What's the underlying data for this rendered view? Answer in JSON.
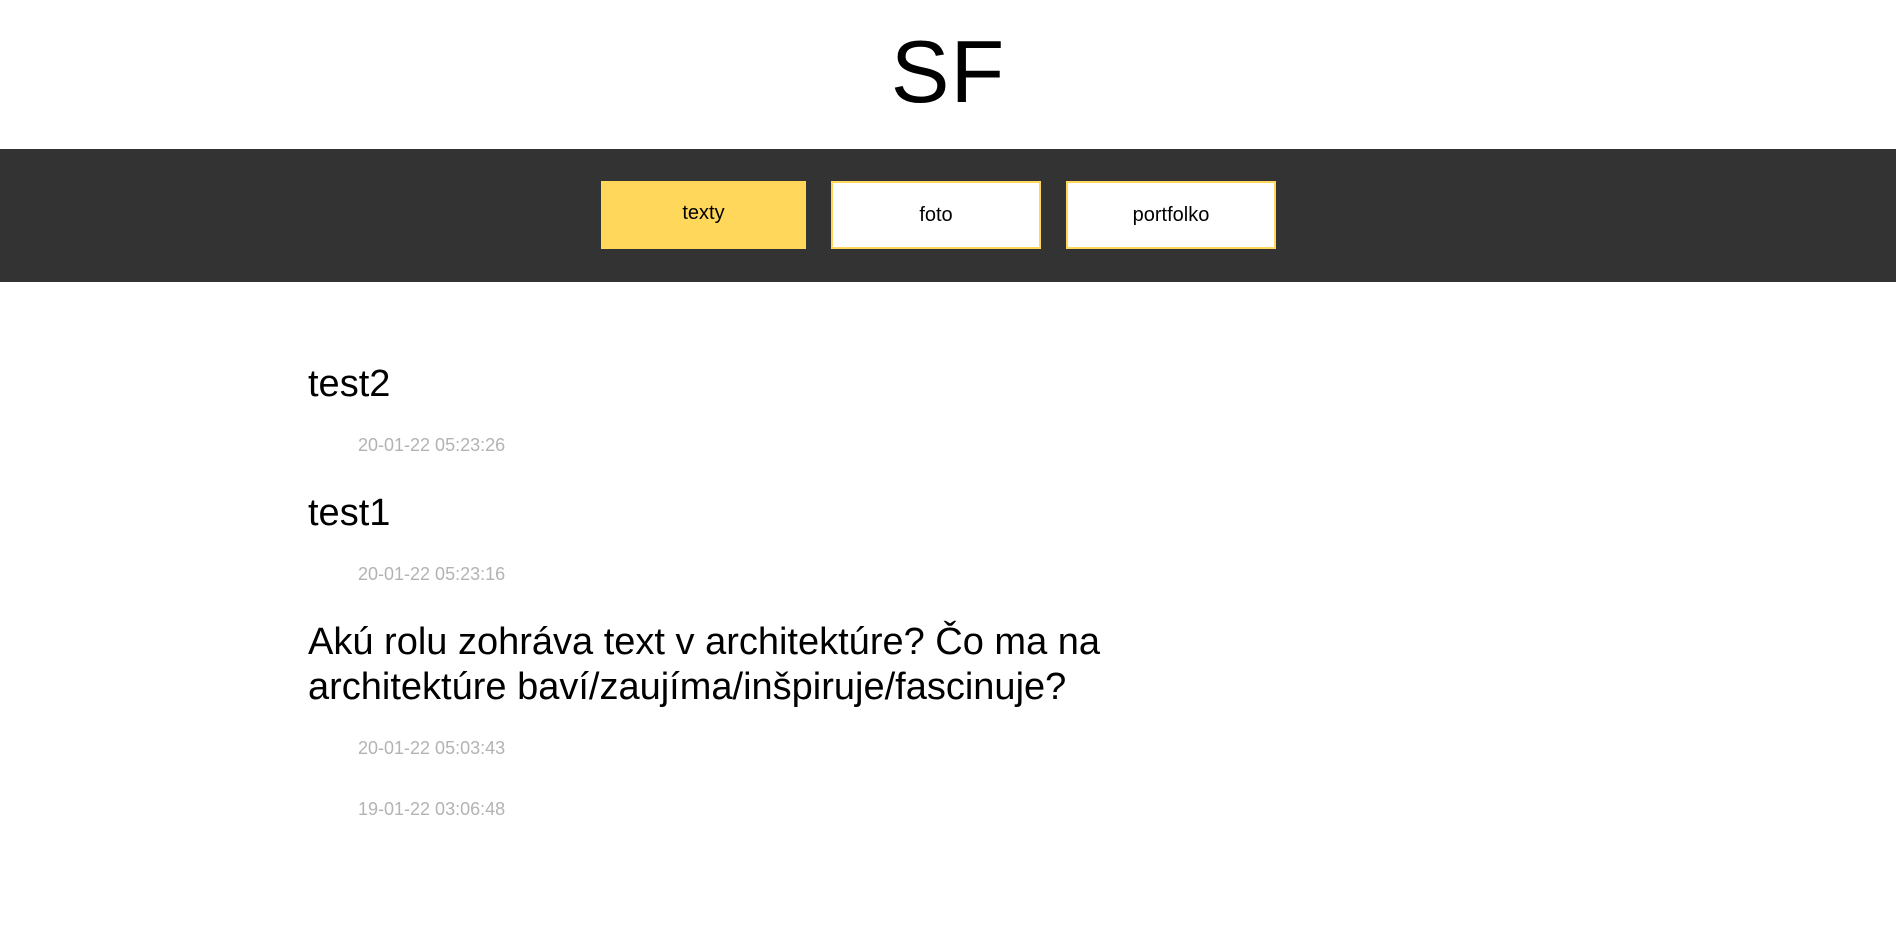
{
  "site": {
    "logo": "SF"
  },
  "nav": {
    "items": [
      {
        "label": "texty"
      },
      {
        "label": "foto"
      },
      {
        "label": "portfolko"
      }
    ],
    "accent": "#ffd75b",
    "background": "#333333"
  },
  "posts": [
    {
      "title": "test2",
      "date": "20-01-22 05:23:26"
    },
    {
      "title": "test1",
      "date": "20-01-22 05:23:16"
    },
    {
      "title": "Akú rolu zohráva text v architektúre? Čo ma na architektúre baví/zaujíma/inšpiruje/fascinuje?",
      "date": "20-01-22 05:03:43"
    },
    {
      "title": "",
      "date": "19-01-22 03:06:48"
    }
  ]
}
